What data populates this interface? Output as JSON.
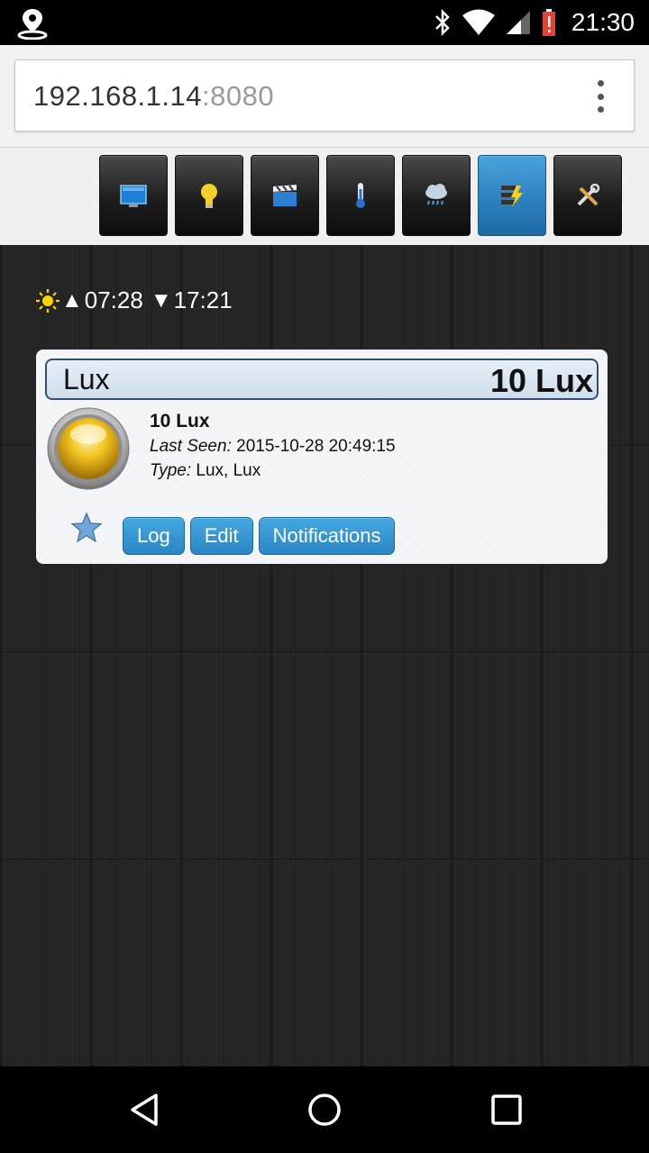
{
  "status_bar": {
    "time": "21:30",
    "icons": [
      "location-icon",
      "bluetooth-icon",
      "wifi-icon",
      "signal-icon",
      "battery-alert-icon"
    ]
  },
  "browser": {
    "url_host": "192.168.1.14",
    "url_port": ":8080",
    "menu_icon": "overflow-menu-icon"
  },
  "toolbar": {
    "buttons": [
      {
        "name": "dashboard",
        "icon": "monitor-icon",
        "active": false
      },
      {
        "name": "lights",
        "icon": "lightbulb-icon",
        "active": false
      },
      {
        "name": "scenes",
        "icon": "clapperboard-icon",
        "active": false
      },
      {
        "name": "temperature",
        "icon": "thermometer-icon",
        "active": false
      },
      {
        "name": "weather",
        "icon": "rain-cloud-icon",
        "active": false
      },
      {
        "name": "utility",
        "icon": "utility-lightning-icon",
        "active": true
      },
      {
        "name": "setup",
        "icon": "tools-icon",
        "active": false
      }
    ],
    "active_color": "#2a7fbb"
  },
  "sun": {
    "sunrise_symbol": "▲",
    "sunrise": "07:28",
    "sunset_symbol": "▼",
    "sunset": "17:21"
  },
  "device": {
    "title": "Lux",
    "value": "10 Lux",
    "status": "10 Lux",
    "last_seen_label": "Last Seen:",
    "last_seen": "2015-10-28 20:49:15",
    "type_label": "Type:",
    "type": "Lux, Lux",
    "buttons": {
      "log": "Log",
      "edit": "Edit",
      "notifications": "Notifications"
    }
  },
  "colors": {
    "button_blue": "#2a86c4",
    "header_border": "#2f4f75",
    "background": "#242424"
  }
}
